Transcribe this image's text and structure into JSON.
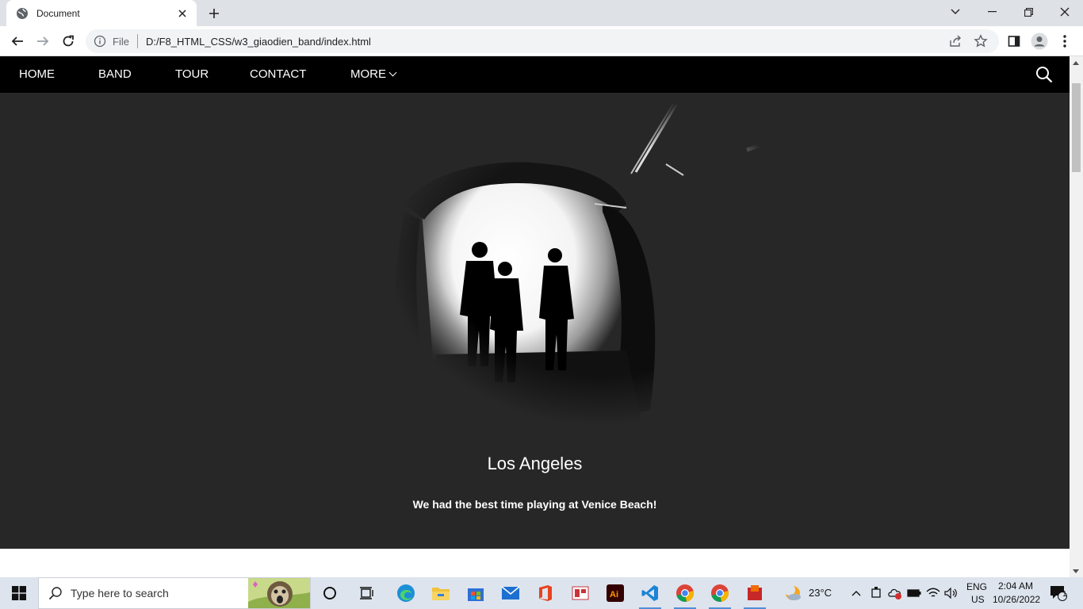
{
  "browser": {
    "tab_title": "Document",
    "url_scheme": "File",
    "url": "D:/F8_HTML_CSS/w3_giaodien_band/index.html"
  },
  "site": {
    "nav": {
      "items": [
        "HOME",
        "BAND",
        "TOUR",
        "CONTACT"
      ],
      "more_label": "MORE"
    },
    "slide": {
      "title": "Los Angeles",
      "text": "We had the best time playing at Venice Beach!"
    }
  },
  "taskbar": {
    "search_placeholder": "Type here to search",
    "weather": "23°C",
    "lang_top": "ENG",
    "lang_bottom": "US",
    "time": "2:04 AM",
    "date": "10/26/2022",
    "notification_count": "1"
  },
  "colors": {
    "nav_bg": "#000000",
    "slide_bg": "#272727",
    "accent": "#1a73e8"
  }
}
